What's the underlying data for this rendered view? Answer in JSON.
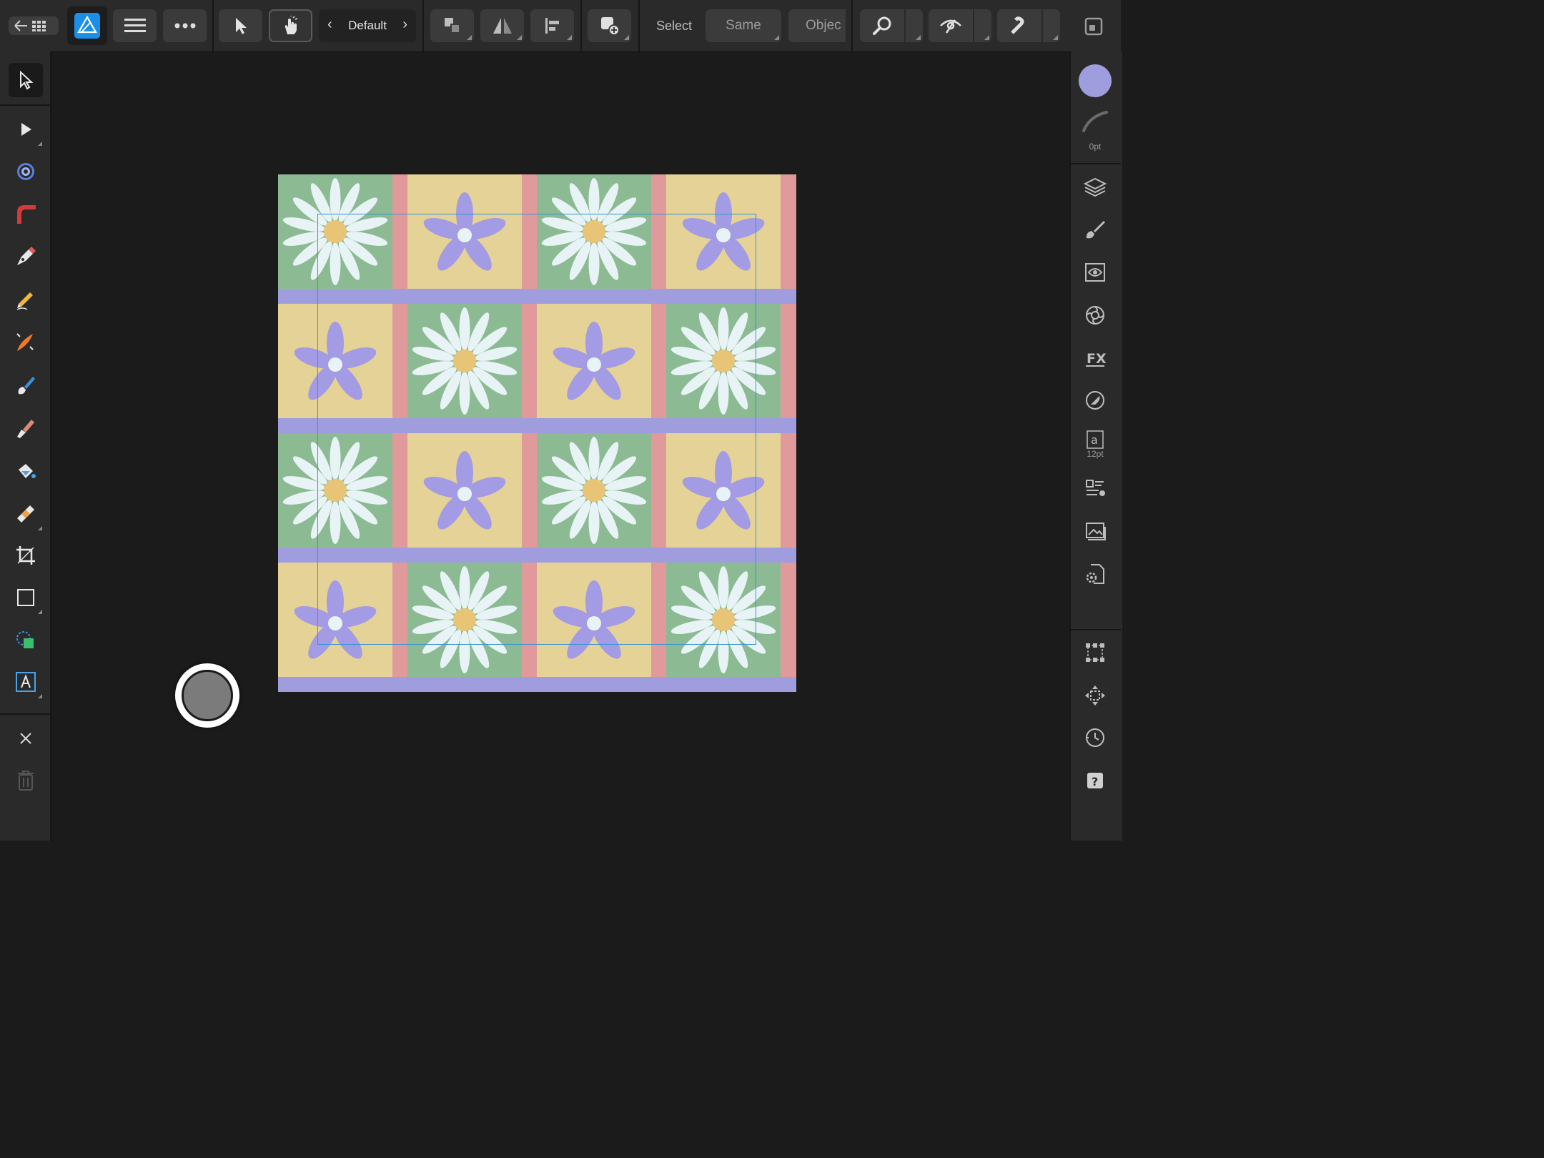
{
  "toolbar": {
    "persona_preset": "Default",
    "select_label": "Select",
    "same_button": "Same",
    "object_button": "Objec"
  },
  "right_panel": {
    "stroke_width": "0pt",
    "font_size": "12pt",
    "fill_color": "#a09ddf"
  },
  "document": {
    "tile_colors": {
      "green": "#8cba93",
      "yellow": "#e5d296",
      "pink": "#e09a9b",
      "lavender": "#a09ddf",
      "petal_white": "#e8f3f6",
      "star_purple": "#a39be3",
      "daisy_center": "#e8c476"
    },
    "grid": [
      [
        "daisy",
        "star",
        "daisy",
        "star"
      ],
      [
        "star",
        "daisy",
        "star",
        "daisy"
      ],
      [
        "daisy",
        "star",
        "daisy",
        "star"
      ],
      [
        "star",
        "daisy",
        "star",
        "daisy"
      ]
    ]
  },
  "icons": [
    "back-grid-icon",
    "affinity-designer-logo-icon",
    "hamburger-menu-icon",
    "more-dots-icon",
    "move-tool-icon",
    "touch-gesture-icon",
    "arrange-icon",
    "flip-icon",
    "align-icon",
    "insert-icon",
    "zoom-icon",
    "view-mode-icon",
    "snapping-magnet-icon",
    "fullscreen-icon"
  ]
}
